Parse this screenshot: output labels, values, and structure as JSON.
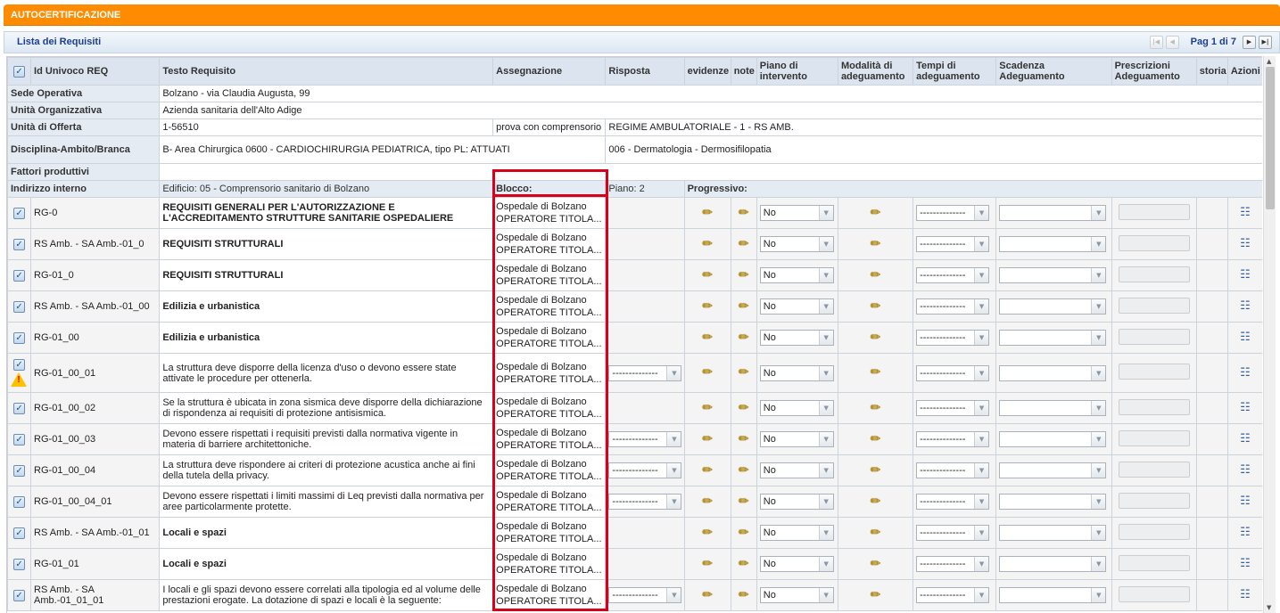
{
  "header": {
    "title": "AUTOCERTIFICAZIONE"
  },
  "list": {
    "title": "Lista dei Requisiti",
    "page_label": "Pag 1 di 7"
  },
  "info": {
    "sede_label": "Sede Operativa",
    "sede_value": "Bolzano - via Claudia Augusta, 99",
    "unita_org_label": "Unità Organizzativa",
    "unita_org_value": "Azienda sanitaria dell'Alto Adige",
    "unita_off_label": "Unità di Offerta",
    "unita_off_code": "1-56510",
    "unita_off_note": "prova con comprensorio",
    "unita_off_regime": "REGIME AMBULATORIALE - 1 - RS AMB.",
    "disciplina_label": "Disciplina-Ambito/Branca",
    "disciplina_value": "B- Area Chirurgica 0600 - CARDIOCHIRURGIA PEDIATRICA, tipo PL: ATTUATI",
    "disciplina_value2": "006 - Dermatologia - Dermosifilopatia",
    "fattori_label": "Fattori produttivi",
    "indirizzo_label": "Indirizzo interno",
    "edificio": "Edificio: 05 - Comprensorio sanitario di Bolzano",
    "blocco": "Blocco:",
    "piano": "Piano: 2",
    "progressivo": "Progressivo:"
  },
  "columns": {
    "id": "Id Univoco REQ",
    "testo": "Testo Requisito",
    "assegnazione": "Assegnazione",
    "risposta": "Risposta",
    "evidenze": "evidenze",
    "note": "note",
    "piano": "Piano di intervento",
    "modalita": "Modalità di adeguamento",
    "tempi": "Tempi di adeguamento",
    "scadenza": "Scadenza Adeguamento",
    "prescrizioni": "Prescrizioni Adeguamento",
    "storia": "storia",
    "azioni": "Azioni"
  },
  "rows": [
    {
      "id": "RG-0",
      "testo": "REQUISITI GENERALI PER L'AUTORIZZAZIONE E L'ACCREDITAMENTO STRUTTURE SANITARIE OSPEDALIERE",
      "bold": true,
      "a1": "Ospedale di Bolzano",
      "a2": "OPERATORE TITOLA...",
      "risposta": "",
      "piano": "No",
      "tempi": "--------------",
      "scadenza": ""
    },
    {
      "id": "RS Amb. - SA Amb.-01_0",
      "testo": "REQUISITI STRUTTURALI",
      "bold": true,
      "a1": "Ospedale di Bolzano",
      "a2": "OPERATORE TITOLA...",
      "risposta": "",
      "piano": "No",
      "tempi": "--------------",
      "scadenza": ""
    },
    {
      "id": "RG-01_0",
      "testo": "REQUISITI STRUTTURALI",
      "bold": true,
      "a1": "Ospedale di Bolzano",
      "a2": "OPERATORE TITOLA...",
      "risposta": "",
      "piano": "No",
      "tempi": "--------------",
      "scadenza": ""
    },
    {
      "id": "RS Amb. - SA Amb.-01_00",
      "testo": "Edilizia e urbanistica",
      "bold": true,
      "a1": "Ospedale di Bolzano",
      "a2": "OPERATORE TITOLA...",
      "risposta": "",
      "piano": "No",
      "tempi": "--------------",
      "scadenza": ""
    },
    {
      "id": "RG-01_00",
      "testo": "Edilizia e urbanistica",
      "bold": true,
      "a1": "Ospedale di Bolzano",
      "a2": "OPERATORE TITOLA...",
      "risposta": "",
      "piano": "No",
      "tempi": "--------------",
      "scadenza": ""
    },
    {
      "id": "RG-01_00_01",
      "testo": "La struttura deve disporre della licenza d'uso o devono essere state attivate le procedure per ottenerla.",
      "bold": false,
      "a1": "Ospedale di Bolzano",
      "a2": "OPERATORE TITOLA...",
      "risposta": "--------------",
      "piano": "No",
      "tempi": "--------------",
      "scadenza": "",
      "warning": true
    },
    {
      "id": "RG-01_00_02",
      "testo": "Se la struttura è ubicata in zona sismica deve disporre della dichiarazione di rispondenza ai requisiti di protezione antisismica.",
      "bold": false,
      "a1": "Ospedale di Bolzano",
      "a2": "OPERATORE TITOLA...",
      "risposta": "",
      "piano": "No",
      "tempi": "--------------",
      "scadenza": ""
    },
    {
      "id": "RG-01_00_03",
      "testo": "Devono essere rispettati i requisiti previsti dalla normativa vigente in materia di barriere architettoniche.",
      "bold": false,
      "a1": "Ospedale di Bolzano",
      "a2": "OPERATORE TITOLA...",
      "risposta": "--------------",
      "piano": "No",
      "tempi": "--------------",
      "scadenza": ""
    },
    {
      "id": "RG-01_00_04",
      "testo": "La struttura deve rispondere ai criteri di protezione acustica anche ai fini della tutela della privacy.",
      "bold": false,
      "a1": "Ospedale di Bolzano",
      "a2": "OPERATORE TITOLA...",
      "risposta": "--------------",
      "piano": "No",
      "tempi": "--------------",
      "scadenza": ""
    },
    {
      "id": "RG-01_00_04_01",
      "testo": "Devono essere rispettati i limiti massimi di Leq previsti dalla normativa per aree particolarmente protette.",
      "bold": false,
      "a1": "Ospedale di Bolzano",
      "a2": "OPERATORE TITOLA...",
      "risposta": "--------------",
      "piano": "No",
      "tempi": "--------------",
      "scadenza": ""
    },
    {
      "id": "RS Amb. - SA Amb.-01_01",
      "testo": "Locali e spazi",
      "bold": true,
      "a1": "Ospedale di Bolzano",
      "a2": "OPERATORE TITOLA...",
      "risposta": "",
      "piano": "No",
      "tempi": "--------------",
      "scadenza": ""
    },
    {
      "id": "RG-01_01",
      "testo": "Locali e spazi",
      "bold": true,
      "a1": "Ospedale di Bolzano",
      "a2": "OPERATORE TITOLA...",
      "risposta": "",
      "piano": "No",
      "tempi": "--------------",
      "scadenza": ""
    },
    {
      "id": "RS Amb. - SA Amb.-01_01_01",
      "testo": "I locali e gli spazi devono essere correlati alla tipologia ed al volume delle prestazioni erogate. La dotazione di spazi e locali è la seguente:",
      "bold": false,
      "a1": "Ospedale di Bolzano",
      "a2": "OPERATORE TITOLA...",
      "risposta": "--------------",
      "piano": "No",
      "tempi": "--------------",
      "scadenza": ""
    }
  ],
  "icons": {
    "edit": "pencil-icon",
    "actions": "list-icon",
    "warning": "warning-icon",
    "checkbox": "checkbox-icon"
  },
  "colors": {
    "header_orange": "#ff8c00",
    "highlight_red": "#d9001b",
    "label_bg": "#e4ebf3"
  }
}
